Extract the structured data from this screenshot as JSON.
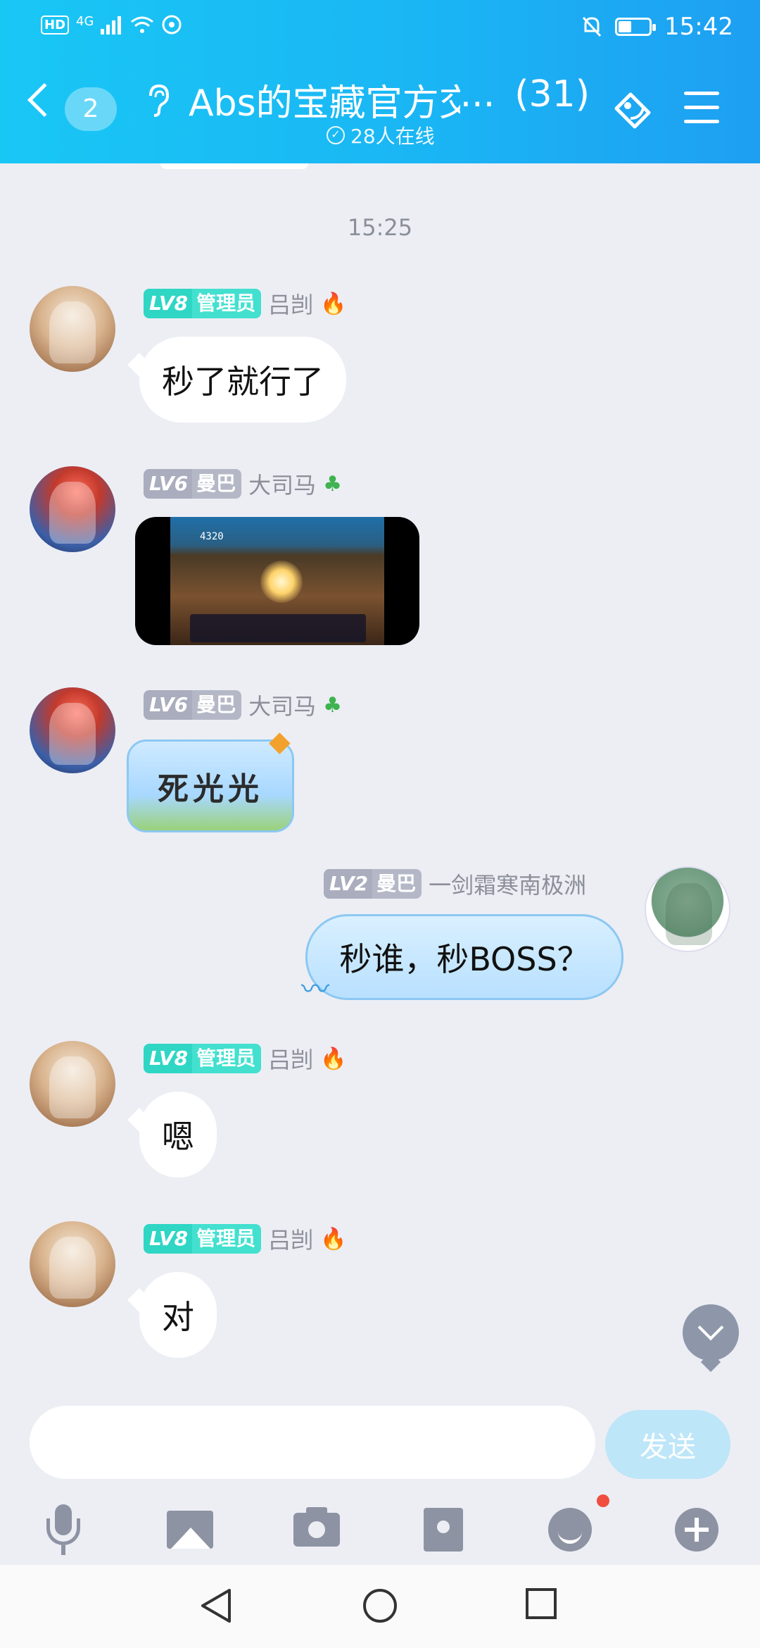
{
  "status_bar": {
    "left_label": "HD",
    "network": "4G",
    "time": "15:42"
  },
  "header": {
    "unread_count": "2",
    "title": "Abs的宝藏官方交",
    "title_ellipsis": "...",
    "member_count": "(31)",
    "online_text": "28人在线"
  },
  "chat": {
    "timestamp": "15:25",
    "messages": [
      {
        "level": "LV8",
        "role": "管理员",
        "name": "吕剀",
        "text": "秒了就行了"
      },
      {
        "level": "LV6",
        "role": "曼巴",
        "name": "大司马",
        "video_score": "4320"
      },
      {
        "level": "LV6",
        "role": "曼巴",
        "name": "大司马",
        "sticker_text": "死光光"
      },
      {
        "level": "LV2",
        "role": "曼巴",
        "name": "一剑霜寒南极洲",
        "text": "秒谁，秒BOSS？"
      },
      {
        "level": "LV8",
        "role": "管理员",
        "name": "吕剀",
        "text": "嗯"
      },
      {
        "level": "LV8",
        "role": "管理员",
        "name": "吕剀",
        "text": "对"
      }
    ]
  },
  "input": {
    "value": "",
    "send_label": "发送"
  },
  "colors": {
    "header_start": "#19c7f5",
    "header_end": "#1e9ff2",
    "admin_tag": "#2fd6c4",
    "member_tag": "#a9adbd",
    "background": "#eceef4"
  }
}
